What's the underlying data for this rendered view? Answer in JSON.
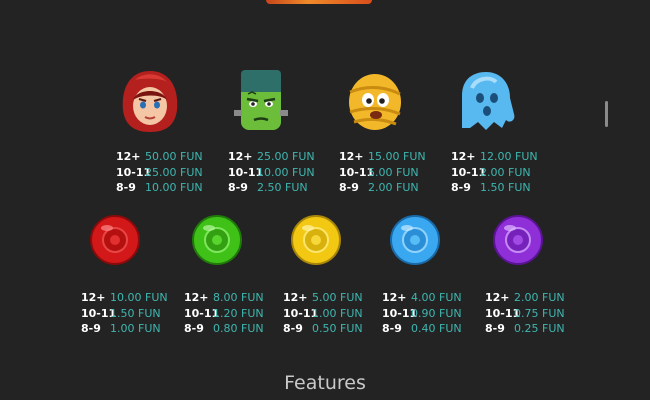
{
  "symbols_row1": [
    {
      "name": "red-riding-hood",
      "pays": [
        {
          "count": "12+",
          "value": "50.00 FUN"
        },
        {
          "count": "10-11",
          "value": "25.00 FUN"
        },
        {
          "count": "8-9",
          "value": "10.00 FUN"
        }
      ]
    },
    {
      "name": "frankenstein",
      "pays": [
        {
          "count": "12+",
          "value": "25.00 FUN"
        },
        {
          "count": "10-11",
          "value": "10.00 FUN"
        },
        {
          "count": "8-9",
          "value": "2.50 FUN"
        }
      ]
    },
    {
      "name": "mummy",
      "pays": [
        {
          "count": "12+",
          "value": "15.00 FUN"
        },
        {
          "count": "10-11",
          "value": "5.00 FUN"
        },
        {
          "count": "8-9",
          "value": "2.00 FUN"
        }
      ]
    },
    {
      "name": "ghost",
      "pays": [
        {
          "count": "12+",
          "value": "12.00 FUN"
        },
        {
          "count": "10-11",
          "value": "2.00 FUN"
        },
        {
          "count": "8-9",
          "value": "1.50 FUN"
        }
      ]
    }
  ],
  "symbols_row2": [
    {
      "name": "red-gem",
      "color": "#d21818",
      "pays": [
        {
          "count": "12+",
          "value": "10.00 FUN"
        },
        {
          "count": "10-11",
          "value": "1.50 FUN"
        },
        {
          "count": "8-9",
          "value": "1.00 FUN"
        }
      ]
    },
    {
      "name": "green-gem",
      "color": "#3fc118",
      "pays": [
        {
          "count": "12+",
          "value": "8.00 FUN"
        },
        {
          "count": "10-11",
          "value": "1.20 FUN"
        },
        {
          "count": "8-9",
          "value": "0.80 FUN"
        }
      ]
    },
    {
      "name": "yellow-gem",
      "color": "#f2c812",
      "pays": [
        {
          "count": "12+",
          "value": "5.00 FUN"
        },
        {
          "count": "10-11",
          "value": "1.00 FUN"
        },
        {
          "count": "8-9",
          "value": "0.50 FUN"
        }
      ]
    },
    {
      "name": "blue-gem",
      "color": "#3aa8f0",
      "pays": [
        {
          "count": "12+",
          "value": "4.00 FUN"
        },
        {
          "count": "10-11",
          "value": "0.90 FUN"
        },
        {
          "count": "8-9",
          "value": "0.40 FUN"
        }
      ]
    },
    {
      "name": "purple-gem",
      "color": "#8e2fd8",
      "pays": [
        {
          "count": "12+",
          "value": "2.00 FUN"
        },
        {
          "count": "10-11",
          "value": "0.75 FUN"
        },
        {
          "count": "8-9",
          "value": "0.25 FUN"
        }
      ]
    }
  ],
  "features_heading": "Features",
  "colors": {
    "background": "#232323",
    "count_text": "#ffffff",
    "value_text": "#3fb6b0"
  }
}
